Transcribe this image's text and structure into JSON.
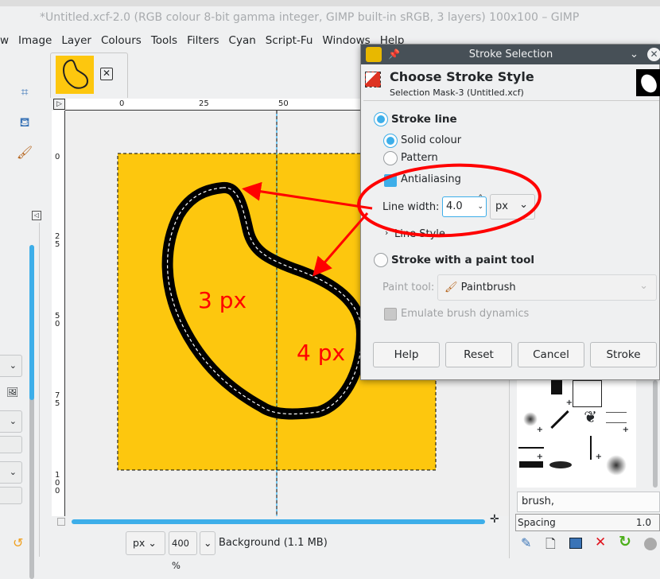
{
  "window": {
    "title": "*Untitled.xcf-2.0 (RGB colour 8-bit gamma integer, GIMP built-in sRGB, 3 layers) 100x100 – GIMP"
  },
  "menu": [
    "w",
    "Image",
    "Layer",
    "Colours",
    "Tools",
    "Filters",
    "Cyan",
    "Script-Fu",
    "Windows",
    "Help"
  ],
  "ruler": {
    "h": [
      "0",
      "25",
      "50"
    ],
    "v": [
      "0",
      "2\n5",
      "5\n0",
      "7\n5",
      "1\n0\n0"
    ]
  },
  "canvas": {
    "annotation_left": "3 px",
    "annotation_right": "4 px",
    "bg_color": "#fdc70e",
    "annotation_color": "#ff0000"
  },
  "status": {
    "unit": "px",
    "zoom": "400 %",
    "layer_info": "Background (1.1 MB)"
  },
  "dialog": {
    "title": "Stroke Selection",
    "heading": "Choose Stroke Style",
    "subheading": "Selection Mask-3 (Untitled.xcf)",
    "stroke_line": "Stroke line",
    "solid_colour": "Solid colour",
    "pattern": "Pattern",
    "antialiasing": "Antialiasing",
    "line_width_label": "Line width:",
    "line_width_value": "4.0",
    "line_width_unit": "px",
    "line_style": "Line Style",
    "stroke_paint_tool": "Stroke with a paint tool",
    "paint_tool_label": "Paint tool:",
    "paint_tool_value": "Paintbrush",
    "emulate": "Emulate brush dynamics",
    "buttons": {
      "help": "Help",
      "reset": "Reset",
      "cancel": "Cancel",
      "stroke": "Stroke"
    }
  },
  "brushes": {
    "filter": "brush,",
    "spacing_label": "Spacing",
    "spacing_value": "1.0"
  }
}
